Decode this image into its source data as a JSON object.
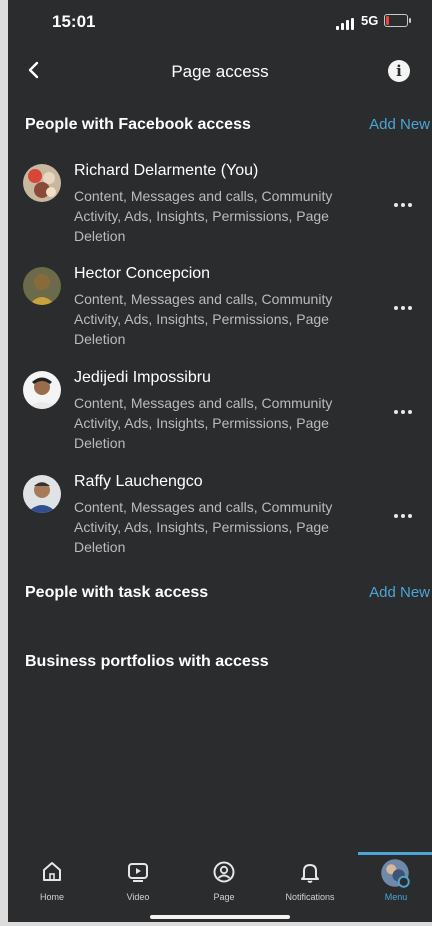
{
  "status_bar": {
    "time": "15:01",
    "network": "5G"
  },
  "header": {
    "title": "Page access"
  },
  "facebook_access": {
    "title": "People with Facebook access",
    "add_new": "Add New",
    "people": [
      {
        "name": "Richard Delarmente (You)",
        "permissions": "Content, Messages and calls, Community Activity, Ads, Insights, Permissions, Page Deletion"
      },
      {
        "name": "Hector Concepcion",
        "permissions": "Content, Messages and calls, Community Activity, Ads, Insights, Permissions, Page Deletion"
      },
      {
        "name": "Jedijedi Impossibru",
        "permissions": "Content, Messages and calls, Community Activity, Ads, Insights, Permissions, Page Deletion"
      },
      {
        "name": "Raffy Lauchengco",
        "permissions": "Content, Messages and calls, Community Activity, Ads, Insights, Permissions, Page Deletion"
      }
    ]
  },
  "task_access": {
    "title": "People with task access",
    "add_new": "Add New"
  },
  "business_portfolios": {
    "title": "Business portfolios with access"
  },
  "bottom_nav": {
    "items": [
      {
        "label": "Home",
        "icon": "home-icon"
      },
      {
        "label": "Video",
        "icon": "video-icon"
      },
      {
        "label": "Page",
        "icon": "page-icon"
      },
      {
        "label": "Notifications",
        "icon": "bell-icon"
      },
      {
        "label": "Menu",
        "icon": "avatar"
      }
    ],
    "active": "Menu"
  },
  "colors": {
    "background": "#2a2c2d",
    "accent": "#4aa6d6",
    "secondary_text": "#b9bcbe"
  }
}
